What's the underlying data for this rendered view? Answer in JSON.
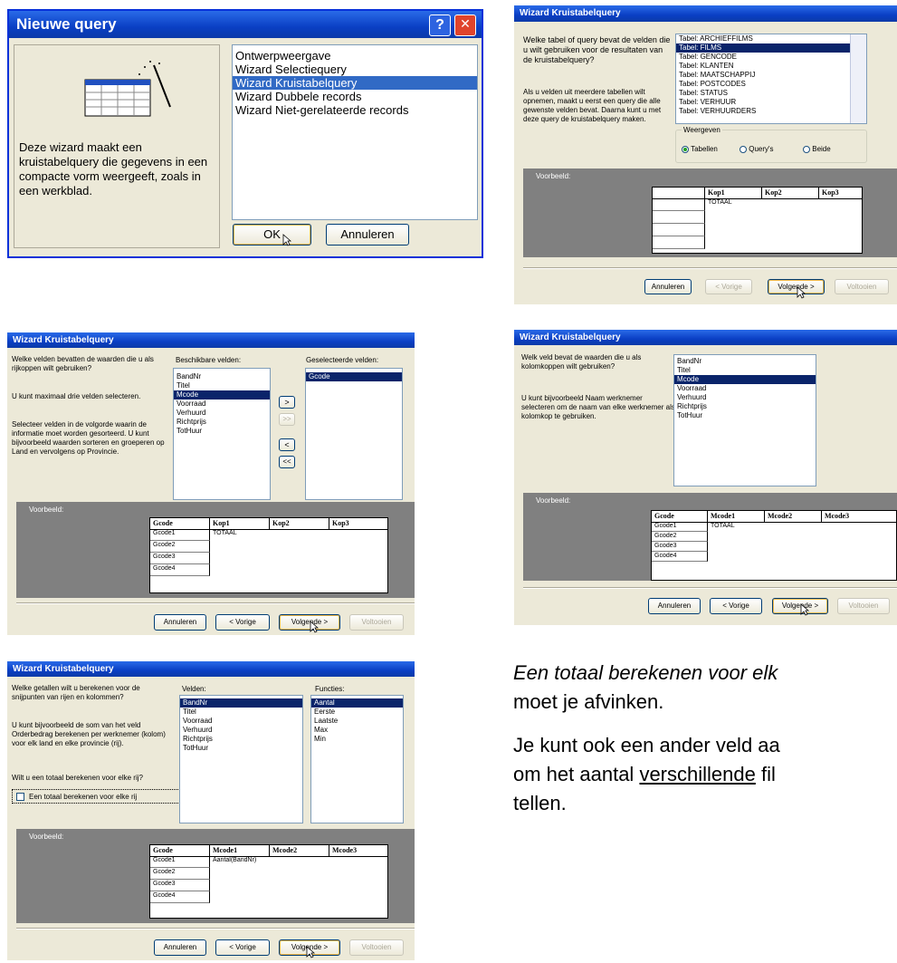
{
  "d1": {
    "title": "Nieuwe query",
    "help_btn": "?",
    "close_btn": "✕",
    "description": "Deze wizard maakt een kruistabelquery die gegevens in een compacte vorm weergeeft, zoals in een werkblad.",
    "options": [
      "Ontwerpweergave",
      "Wizard Selectiequery",
      "Wizard Kruistabelquery",
      "Wizard Dubbele records",
      "Wizard Niet-gerelateerde records"
    ],
    "selected_index": 2,
    "ok": "OK",
    "cancel": "Annuleren"
  },
  "d2": {
    "title": "Wizard Kruistabelquery",
    "question": "Welke tabel of query bevat de velden die u wilt gebruiken voor de resultaten van de kruistabelquery?",
    "info": "Als u velden uit meerdere tabellen wilt opnemen, maakt u eerst een query die alle gewenste velden bevat. Daarna kunt u met deze query de kruistabelquery maken.",
    "tables": [
      "Tabel: ARCHIEFFILMS",
      "Tabel: FILMS",
      "Tabel: GENCODE",
      "Tabel: KLANTEN",
      "Tabel: MAATSCHAPPIJ",
      "Tabel: POSTCODES",
      "Tabel: STATUS",
      "Tabel: VERHUUR",
      "Tabel: VERHUURDERS"
    ],
    "selected_index": 1,
    "view_group": "Weergeven",
    "view_options": [
      "Tabellen",
      "Query's",
      "Beide"
    ],
    "preview_label": "Voorbeeld:",
    "headers": [
      "Kop1",
      "Kop2",
      "Kop3"
    ],
    "total": "TOTAAL",
    "buttons": [
      "Annuleren",
      "< Vorige",
      "Volgende >",
      "Voltooien"
    ]
  },
  "d3": {
    "title": "Wizard Kruistabelquery",
    "question": "Welke velden bevatten de waarden die u als rijkoppen wilt gebruiken?",
    "max_text": "U kunt maximaal drie velden selecteren.",
    "order_text": "Selecteer velden in de volgorde waarin de informatie moet worden gesorteerd. U kunt bijvoorbeeld waarden sorteren en groeperen op Land en vervolgens op Provincie.",
    "available_label": "Beschikbare velden:",
    "selected_label": "Geselecteerde velden:",
    "available": [
      "BandNr",
      "Titel",
      "Mcode",
      "Voorraad",
      "Verhuurd",
      "Richtprijs",
      "TotHuur"
    ],
    "available_selected_index": 2,
    "selected": [
      "Gcode"
    ],
    "move_buttons": [
      ">",
      ">>",
      "<",
      "<<"
    ],
    "preview_label": "Voorbeeld:",
    "headers": [
      "Gcode",
      "Kop1",
      "Kop2",
      "Kop3"
    ],
    "rows": [
      "Gcode1",
      "Gcode2",
      "Gcode3",
      "Gcode4"
    ],
    "total": "TOTAAL",
    "buttons": [
      "Annuleren",
      "< Vorige",
      "Volgende >",
      "Voltooien"
    ]
  },
  "d4": {
    "title": "Wizard Kruistabelquery",
    "question": "Welk veld bevat de waarden die u als kolomkoppen wilt gebruiken?",
    "example": "U kunt bijvoorbeeld Naam werknemer selecteren om de naam van elke werknemer als kolomkop te gebruiken.",
    "fields": [
      "BandNr",
      "Titel",
      "Mcode",
      "Voorraad",
      "Verhuurd",
      "Richtprijs",
      "TotHuur"
    ],
    "selected_index": 2,
    "preview_label": "Voorbeeld:",
    "headers": [
      "Gcode",
      "Mcode1",
      "Mcode2",
      "Mcode3"
    ],
    "rows": [
      "Gcode1",
      "Gcode2",
      "Gcode3",
      "Gcode4"
    ],
    "total": "TOTAAL",
    "buttons": [
      "Annuleren",
      "< Vorige",
      "Volgende >",
      "Voltooien"
    ]
  },
  "d5": {
    "title": "Wizard Kruistabelquery",
    "question": "Welke getallen wilt u berekenen voor de snijpunten van rijen en kolommen?",
    "example": "U kunt bijvoorbeeld de som van het veld Orderbedrag berekenen per werknemer (kolom) voor elk land en elke provincie (rij).",
    "total_question": "Wilt u een totaal berekenen voor elke rij?",
    "checkbox_label": "Een totaal berekenen voor elke rij",
    "fields_label": "Velden:",
    "functions_label": "Functies:",
    "fields": [
      "BandNr",
      "Titel",
      "Voorraad",
      "Verhuurd",
      "Richtprijs",
      "TotHuur"
    ],
    "functions": [
      "Aantal",
      "Eerste",
      "Laatste",
      "Max",
      "Min"
    ],
    "preview_label": "Voorbeeld:",
    "headers": [
      "Gcode",
      "Mcode1",
      "Mcode2",
      "Mcode3"
    ],
    "rows": [
      "Gcode1",
      "Gcode2",
      "Gcode3",
      "Gcode4"
    ],
    "cell_value": "Aantal(BandNr)",
    "buttons": [
      "Annuleren",
      "< Vorige",
      "Volgende >",
      "Voltooien"
    ]
  },
  "note": {
    "line1": "Een totaal berekenen voor elk",
    "line2": "moet je afvinken.",
    "line3": "Je kunt ook een ander veld aa",
    "line4_pre": "om het aantal ",
    "line4_underlined": "verschillende",
    "line4_post": " fil",
    "line5": "tellen."
  },
  "colors": {
    "title_blue": "#0a3fc4",
    "dialog_bg": "#ece9d8",
    "selection": "#0a246a",
    "preview_gray": "#808080",
    "close_red": "#e0442c"
  }
}
